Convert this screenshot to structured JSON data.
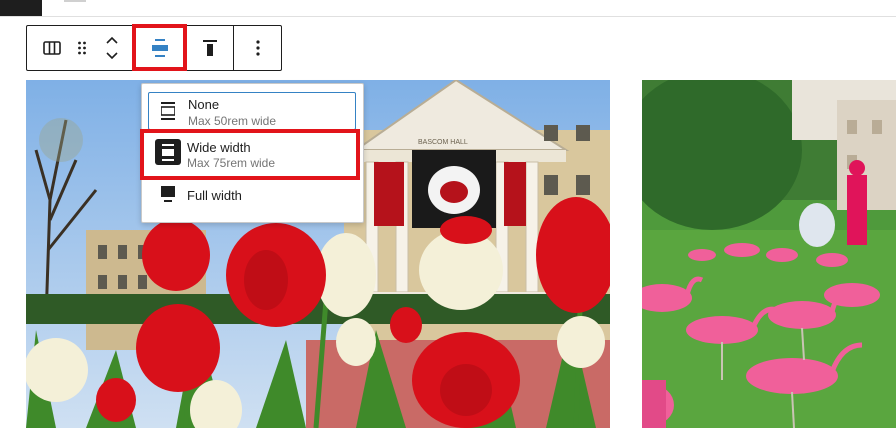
{
  "toolbar": {
    "buttons": [
      {
        "name": "block-type",
        "icon": "columns-icon"
      },
      {
        "name": "drag-handle",
        "icon": "drag-handle-icon"
      },
      {
        "name": "move",
        "icon": "move-up-down-icon"
      },
      {
        "name": "align",
        "icon": "align-center-icon",
        "active": true
      },
      {
        "name": "text-align",
        "icon": "justify-top-icon"
      },
      {
        "name": "more-options",
        "icon": "more-vertical-icon"
      }
    ]
  },
  "dropdown": {
    "options": [
      {
        "title": "None",
        "subtitle": "Max 50rem wide",
        "icon": "none-width-icon"
      },
      {
        "title": "Wide width",
        "subtitle": "Max 75rem wide",
        "icon": "wide-width-icon"
      },
      {
        "title": "Full width",
        "subtitle": "",
        "icon": "full-width-icon"
      }
    ]
  },
  "photo": {
    "building_sign": "BASCOM HALL"
  },
  "colors": {
    "highlight": "#e2141a",
    "wp_blue": "#3582c4",
    "dark": "#1e1e1e",
    "muted": "#757575"
  }
}
